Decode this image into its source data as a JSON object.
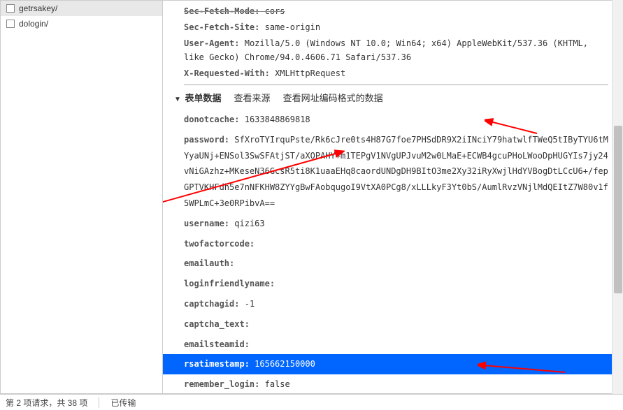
{
  "sidebar": {
    "items": [
      {
        "label": "getrsakey/"
      },
      {
        "label": "dologin/"
      }
    ]
  },
  "headers": {
    "secFetchMode": {
      "key": "Sec-Fetch-Mode:",
      "val": "cors"
    },
    "secFetchSite": {
      "key": "Sec-Fetch-Site:",
      "val": "same-origin"
    },
    "userAgent": {
      "key": "User-Agent:",
      "val": "Mozilla/5.0 (Windows NT 10.0; Win64; x64) AppleWebKit/537.36 (KHTML, like Gecko) Chrome/94.0.4606.71 Safari/537.36"
    },
    "xRequestedWith": {
      "key": "X-Requested-With:",
      "val": "XMLHttpRequest"
    }
  },
  "formSection": {
    "title": "表单数据",
    "link1": "查看来源",
    "link2": "查看网址编码格式的数据"
  },
  "form": {
    "donotcache": {
      "key": "donotcache:",
      "val": "1633848869818"
    },
    "password": {
      "key": "password:",
      "val": "SfXroTYIrquPste/Rk6cJre0ts4H87G7foe7PHSdDR9X2iINciY79hatwlfTWeQ5tIByTYU6tMYyaUNj+ENSol3SwSFAtjST/aXOPAHY+m1TEPgV1NVgUPJvuM2w0LMaE+ECWB4gcuPHoLWooDpHUGYIs7jy24vNiGAzhz+MKeseN36GcsR5ti8K1uaaEHq8caordUNDgDH9BItO3me2Xy32iRyXwjlHdYVBogDtLCcU6+/fepGPTVKHFdh5e7nNFKHW8ZYYgBwFAobqugoI9VtXA0PCg8/xLLLkyF3Yt0bS/AumlRvzVNjlMdQEItZ7W80v1f5WPLmC+3e0RPibvA=="
    },
    "username": {
      "key": "username:",
      "val": "qizi63"
    },
    "twofactorcode": {
      "key": "twofactorcode:",
      "val": ""
    },
    "emailauth": {
      "key": "emailauth:",
      "val": ""
    },
    "loginfriendlyname": {
      "key": "loginfriendlyname:",
      "val": ""
    },
    "captchagid": {
      "key": "captchagid:",
      "val": "-1"
    },
    "captcha_text": {
      "key": "captcha_text:",
      "val": ""
    },
    "emailsteamid": {
      "key": "emailsteamid:",
      "val": ""
    },
    "rsatimestamp": {
      "key": "rsatimestamp:",
      "val": "165662150000"
    },
    "remember_login": {
      "key": "remember_login:",
      "val": "false"
    }
  },
  "statusbar": {
    "requests": "第 2 项请求，共 38 项",
    "transferred": "已传输"
  }
}
